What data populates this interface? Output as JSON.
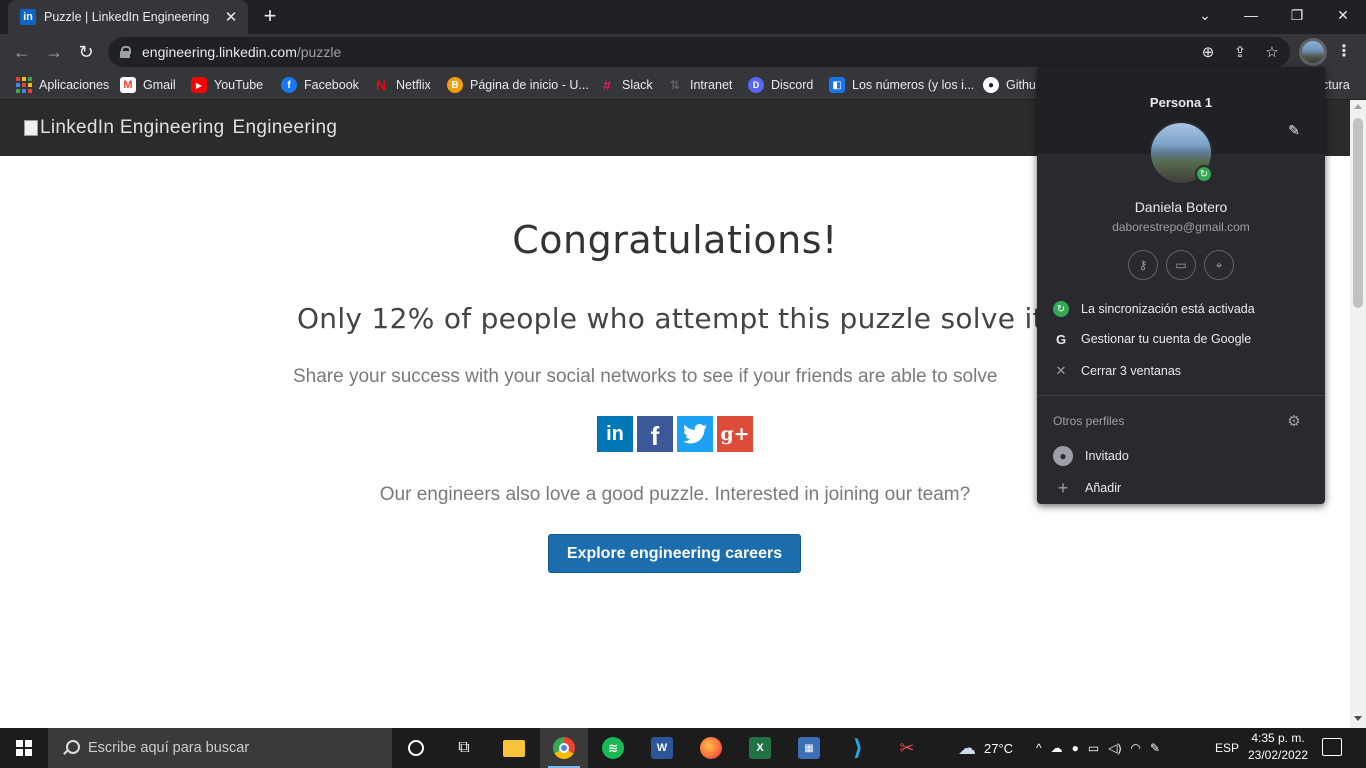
{
  "browser": {
    "tab": {
      "title": "Puzzle | LinkedIn Engineering",
      "favicon": "in"
    },
    "url": {
      "host": "engineering.linkedin.com",
      "path": "/puzzle"
    },
    "bookmarks": [
      {
        "label": "Aplicaciones",
        "icon": "apps-grid-icon",
        "color": "#ea4335"
      },
      {
        "label": "Gmail",
        "icon": "gmail-icon",
        "color": "#ea4335"
      },
      {
        "label": "YouTube",
        "icon": "youtube-icon",
        "color": "#ff0000"
      },
      {
        "label": "Facebook",
        "icon": "facebook-icon",
        "color": "#1877f2"
      },
      {
        "label": "Netflix",
        "icon": "netflix-icon",
        "color": "#e50914"
      },
      {
        "label": "Página de inicio - U...",
        "icon": "home-page-icon",
        "color": "#f59e0b"
      },
      {
        "label": "Slack",
        "icon": "slack-icon",
        "color": "#4a154b"
      },
      {
        "label": "Intranet",
        "icon": "intranet-icon",
        "color": "#5f6368"
      },
      {
        "label": "Discord",
        "icon": "discord-icon",
        "color": "#5865f2"
      },
      {
        "label": "Los números (y los i...",
        "icon": "bookmark-page-icon",
        "color": "#1a73e8"
      },
      {
        "label": "Githu",
        "icon": "github-icon",
        "color": "#ffffff"
      },
      {
        "label": "ctura",
        "icon": "",
        "color": ""
      }
    ]
  },
  "site": {
    "logo_alt": "LinkedIn Engineering",
    "brand": "Engineering"
  },
  "page": {
    "title": "Congratulations!",
    "subtitle": "Only 12% of people who attempt this puzzle solve it.",
    "share_text": "Share your success with your social networks to see if your friends are able to solve",
    "social": [
      {
        "name": "linkedin",
        "glyph": "in",
        "color": "#0077b5"
      },
      {
        "name": "facebook",
        "glyph": "f",
        "color": "#3b5998"
      },
      {
        "name": "twitter",
        "glyph": "t",
        "color": "#1da1f2"
      },
      {
        "name": "google-plus",
        "glyph": "g+",
        "color": "#dd4b39"
      }
    ],
    "engineers_text": "Our engineers also love a good puzzle. Interested in joining our team?",
    "cta_label": "Explore engineering careers"
  },
  "profile_menu": {
    "title": "Persona 1",
    "name": "Daniela Botero",
    "email": "daborestrepo@gmail.com",
    "sync_label": "La sincronización está activada",
    "manage_label": "Gestionar tu cuenta de Google",
    "close_label": "Cerrar 3 ventanas",
    "other_profiles_label": "Otros perfiles",
    "guest_label": "Invitado",
    "add_label": "Añadir"
  },
  "taskbar": {
    "search_placeholder": "Escribe aquí para buscar",
    "weather": "27°C",
    "language": "ESP",
    "time": "4:35 p. m.",
    "date": "23/02/2022"
  },
  "colors": {
    "chrome_dark": "#202124",
    "chrome_toolbar": "#35363a",
    "cta_blue": "#1b6dae",
    "sync_green": "#34a853"
  }
}
